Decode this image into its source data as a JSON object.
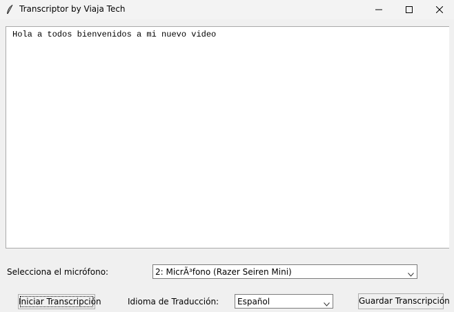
{
  "window": {
    "title": "Transcriptor by Viaja Tech",
    "app_icon": "feather-icon",
    "controls": [
      "minimize-icon",
      "maximize-icon",
      "close-icon"
    ]
  },
  "transcript": {
    "text": "Hola a todos bienvenidos a mi nuevo video"
  },
  "microphone": {
    "label": "Selecciona el micrófono:",
    "selected": "2: MicrÃ³fono (Razer Seiren Mini)"
  },
  "controls": {
    "start_button": "Iniciar Transcripción",
    "language_label": "Idioma de Traducción:",
    "language_selected": "Español",
    "save_button": "Guardar Transcripción"
  }
}
